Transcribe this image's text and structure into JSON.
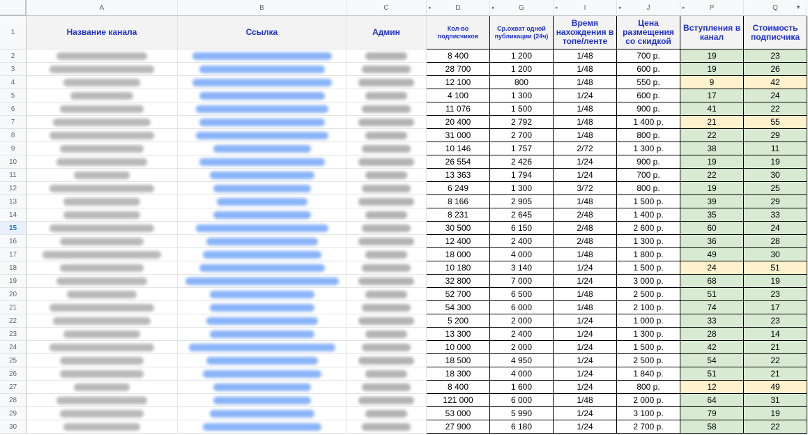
{
  "column_letters": [
    "A",
    "B",
    "C",
    "D",
    "G",
    "I",
    "J",
    "P",
    "Q"
  ],
  "headers": {
    "name": "Название канала",
    "link": "Ссылка",
    "admin": "Админ",
    "subscribers": "Кол-во подписчиков",
    "reach": "Ср.охват одной публикации (24ч)",
    "time": "Время нахождения в топе/ленте",
    "price": "Цена размещения со скидкой",
    "joins": "Вступления в канал",
    "cost": "Стоимость подписчика"
  },
  "selected_row": 15,
  "colors": {
    "green": "#d9ead3",
    "yellow": "#fff2cc",
    "header_text": "#1d2fd6"
  },
  "rows": [
    {
      "n": "2",
      "subs": "8 400",
      "reach": "1 200",
      "time": "1/48",
      "price": "700 р.",
      "joins": "19",
      "cost": "23",
      "hl": "green"
    },
    {
      "n": "3",
      "subs": "28 700",
      "reach": "1 200",
      "time": "1/48",
      "price": "600 р.",
      "joins": "19",
      "cost": "26",
      "hl": "green"
    },
    {
      "n": "4",
      "subs": "12 100",
      "reach": "800",
      "time": "1/48",
      "price": "550 р.",
      "joins": "9",
      "cost": "42",
      "hl": "yellow"
    },
    {
      "n": "5",
      "subs": "4 100",
      "reach": "1 300",
      "time": "1/24",
      "price": "600 р.",
      "joins": "17",
      "cost": "24",
      "hl": "green"
    },
    {
      "n": "6",
      "subs": "11 076",
      "reach": "1 500",
      "time": "1/48",
      "price": "900 р.",
      "joins": "41",
      "cost": "22",
      "hl": "green"
    },
    {
      "n": "7",
      "subs": "20 400",
      "reach": "2 792",
      "time": "1/48",
      "price": "1 400 р.",
      "joins": "21",
      "cost": "55",
      "hl": "yellow"
    },
    {
      "n": "8",
      "subs": "31 000",
      "reach": "2 700",
      "time": "1/48",
      "price": "800 р.",
      "joins": "22",
      "cost": "29",
      "hl": "green"
    },
    {
      "n": "9",
      "subs": "10 146",
      "reach": "1 757",
      "time": "2/72",
      "price": "1 300 р.",
      "joins": "38",
      "cost": "11",
      "hl": "green"
    },
    {
      "n": "10",
      "subs": "26 554",
      "reach": "2 426",
      "time": "1/24",
      "price": "900 р.",
      "joins": "19",
      "cost": "19",
      "hl": "green"
    },
    {
      "n": "11",
      "subs": "13 363",
      "reach": "1 794",
      "time": "1/24",
      "price": "700 р.",
      "joins": "22",
      "cost": "30",
      "hl": "green"
    },
    {
      "n": "12",
      "subs": "6 249",
      "reach": "1 300",
      "time": "3/72",
      "price": "800 р.",
      "joins": "19",
      "cost": "25",
      "hl": "green"
    },
    {
      "n": "13",
      "subs": "8 166",
      "reach": "2 905",
      "time": "1/48",
      "price": "1 500 р.",
      "joins": "39",
      "cost": "29",
      "hl": "green"
    },
    {
      "n": "14",
      "subs": "8 231",
      "reach": "2 645",
      "time": "2/48",
      "price": "1 400 р.",
      "joins": "35",
      "cost": "33",
      "hl": "green"
    },
    {
      "n": "15",
      "subs": "30 500",
      "reach": "6 150",
      "time": "2/48",
      "price": "2 600 р.",
      "joins": "60",
      "cost": "24",
      "hl": "green"
    },
    {
      "n": "16",
      "subs": "12 400",
      "reach": "2 400",
      "time": "2/48",
      "price": "1 300 р.",
      "joins": "36",
      "cost": "28",
      "hl": "green"
    },
    {
      "n": "17",
      "subs": "18 000",
      "reach": "4 000",
      "time": "1/48",
      "price": "1 800 р.",
      "joins": "49",
      "cost": "30",
      "hl": "green"
    },
    {
      "n": "18",
      "subs": "10 180",
      "reach": "3 140",
      "time": "1/24",
      "price": "1 500 р.",
      "joins": "24",
      "cost": "51",
      "hl": "yellow"
    },
    {
      "n": "19",
      "subs": "32 800",
      "reach": "7 000",
      "time": "1/24",
      "price": "3 000 р.",
      "joins": "68",
      "cost": "19",
      "hl": "green"
    },
    {
      "n": "20",
      "subs": "52 700",
      "reach": "6 500",
      "time": "1/48",
      "price": "2 500 р.",
      "joins": "51",
      "cost": "23",
      "hl": "green"
    },
    {
      "n": "21",
      "subs": "54 300",
      "reach": "6 000",
      "time": "1/48",
      "price": "2 100 р.",
      "joins": "74",
      "cost": "17",
      "hl": "green"
    },
    {
      "n": "22",
      "subs": "5 200",
      "reach": "2 000",
      "time": "1/24",
      "price": "1 000 р.",
      "joins": "33",
      "cost": "23",
      "hl": "green"
    },
    {
      "n": "23",
      "subs": "13 300",
      "reach": "2 400",
      "time": "1/24",
      "price": "1 300 р.",
      "joins": "28",
      "cost": "14",
      "hl": "green"
    },
    {
      "n": "24",
      "subs": "10 000",
      "reach": "2 000",
      "time": "1/24",
      "price": "1 500 р.",
      "joins": "42",
      "cost": "21",
      "hl": "green"
    },
    {
      "n": "25",
      "subs": "18 500",
      "reach": "4 950",
      "time": "1/24",
      "price": "2 500 р.",
      "joins": "54",
      "cost": "22",
      "hl": "green"
    },
    {
      "n": "26",
      "subs": "18 300",
      "reach": "4 000",
      "time": "1/24",
      "price": "1 840 р.",
      "joins": "51",
      "cost": "21",
      "hl": "green"
    },
    {
      "n": "27",
      "subs": "8 400",
      "reach": "1 600",
      "time": "1/24",
      "price": "800 р.",
      "joins": "12",
      "cost": "49",
      "hl": "yellow"
    },
    {
      "n": "28",
      "subs": "121 000",
      "reach": "6 000",
      "time": "1/48",
      "price": "2 000 р.",
      "joins": "64",
      "cost": "31",
      "hl": "green"
    },
    {
      "n": "29",
      "subs": "53 000",
      "reach": "5 990",
      "time": "1/24",
      "price": "3 100 р.",
      "joins": "79",
      "cost": "19",
      "hl": "green"
    },
    {
      "n": "30",
      "subs": "27 900",
      "reach": "6 180",
      "time": "1/24",
      "price": "2 700 р.",
      "joins": "58",
      "cost": "22",
      "hl": "green"
    }
  ]
}
